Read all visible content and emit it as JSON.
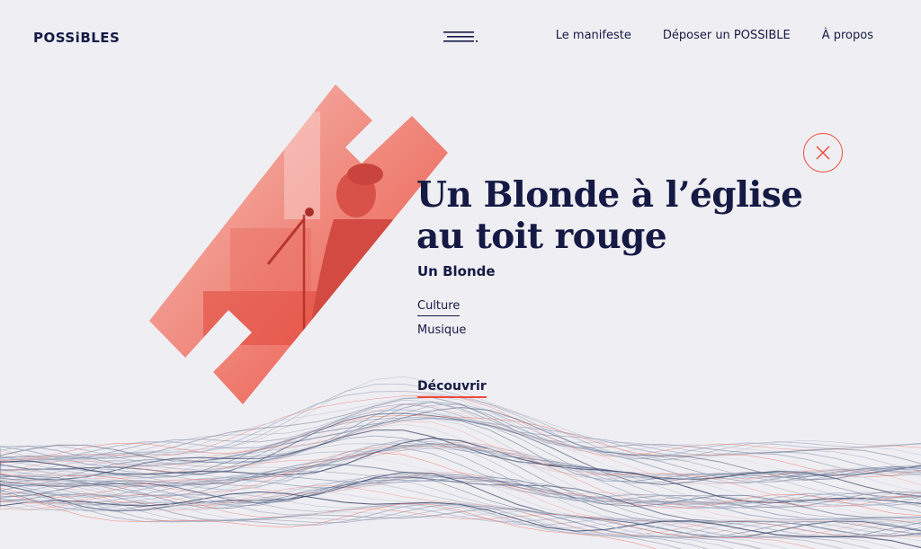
{
  "header": {
    "logo": "POSSiBLES",
    "menu_icon": "hamburger-menu-icon",
    "nav": [
      {
        "label": "Le manifeste"
      },
      {
        "label": "Déposer un POSSIBLE"
      },
      {
        "label": "À propos"
      }
    ]
  },
  "hero": {
    "title": "Un Blonde à l’église au toit rouge",
    "artist": "Un Blonde",
    "tags": [
      "Culture",
      "Musique"
    ],
    "cta_label": "Découvrir",
    "close_icon": "close-icon"
  },
  "colors": {
    "accent": "#ef4b3c",
    "ink": "#151a45",
    "background": "#efeef2"
  }
}
